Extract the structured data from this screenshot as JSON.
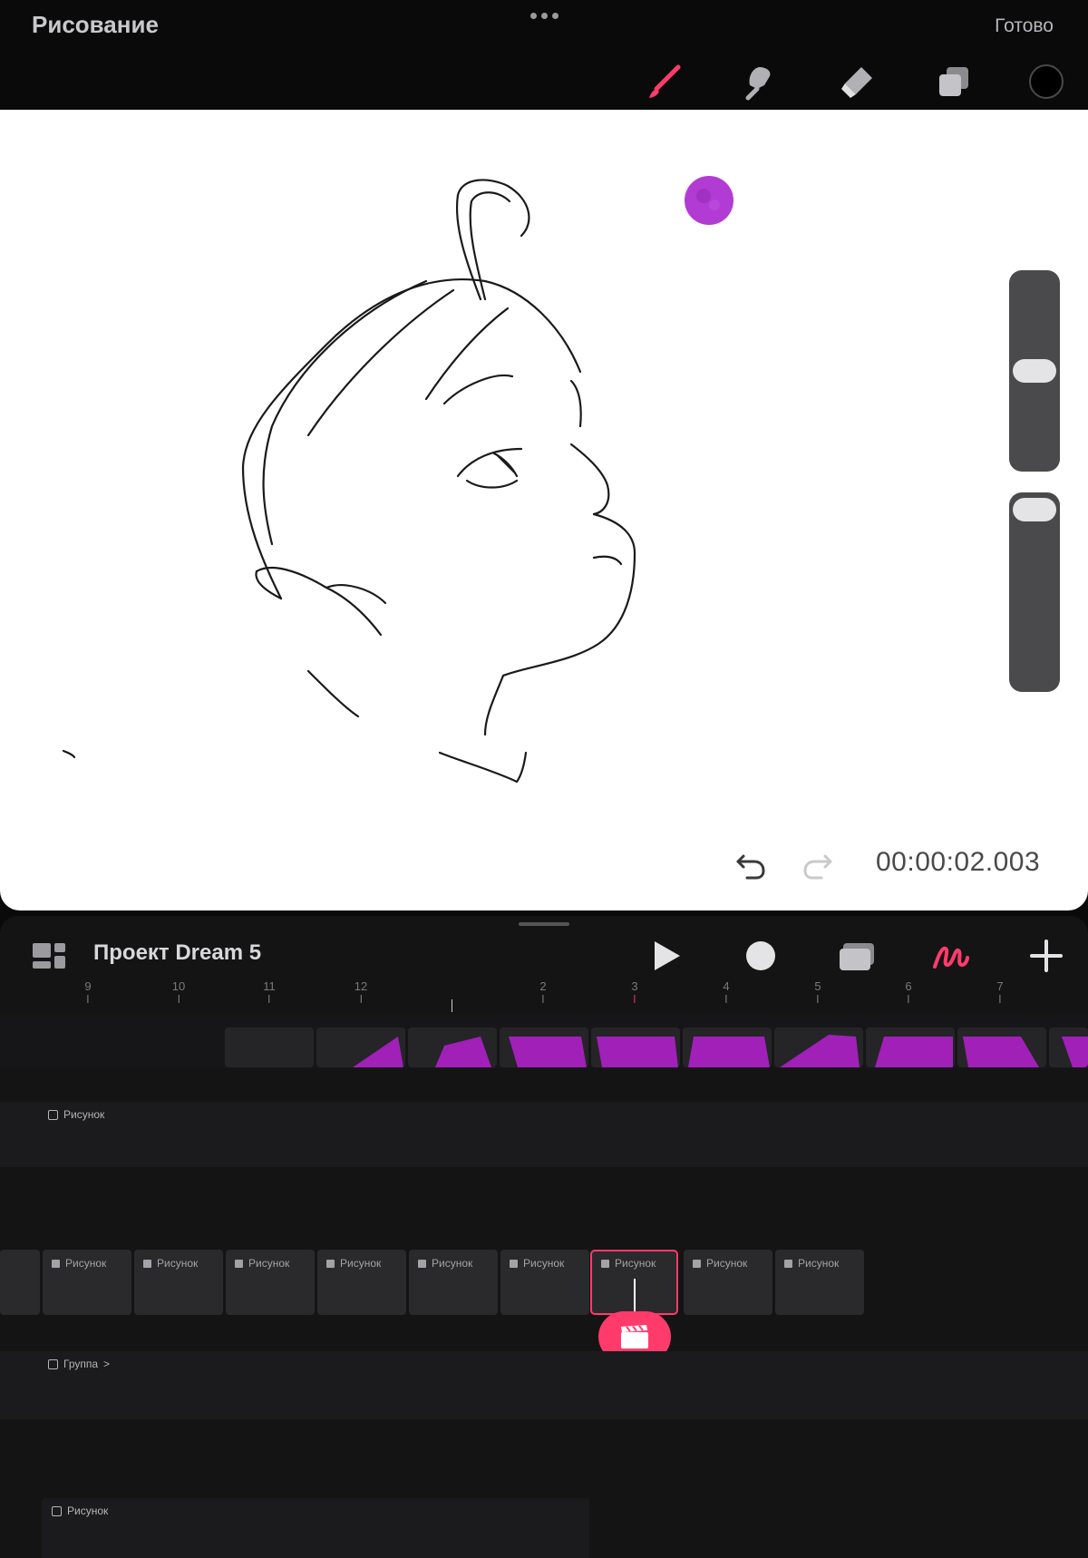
{
  "topbar": {
    "title": "Рисование",
    "done_label": "Готово",
    "tools": [
      {
        "name": "brush",
        "icon": "brush-icon",
        "active": true
      },
      {
        "name": "smudge",
        "icon": "smudge-icon"
      },
      {
        "name": "eraser",
        "icon": "eraser-icon"
      },
      {
        "name": "layers",
        "icon": "layers-icon"
      }
    ],
    "color": "#000000",
    "accent": "#ff3b6b"
  },
  "canvas": {
    "timecode": "00:00:02.003",
    "undo_icon": "undo-icon",
    "redo_icon": "redo-icon",
    "brush_preview_color": "#b23bd4"
  },
  "timeline": {
    "project_name": "Проект Dream 5",
    "header_icons": [
      "gallery-icon",
      "play-icon",
      "record-icon",
      "onion-skin-icon",
      "draw-icon",
      "plus-icon"
    ],
    "ruler": [
      "9",
      "10",
      "11",
      "12",
      "2",
      "3",
      "4",
      "5",
      "6",
      "7"
    ],
    "time_marker": "2s",
    "tracks": [
      {
        "label": "Рисунок"
      },
      {
        "label": "Рисунок"
      },
      {
        "label": "Группа",
        "has_chevron": true
      },
      {
        "label": "Рисунок"
      }
    ],
    "frames": [
      {
        "label": "Рисунок"
      },
      {
        "label": "Рисунок"
      },
      {
        "label": "Рисунок"
      },
      {
        "label": "Рисунок"
      },
      {
        "label": "Рисунок"
      },
      {
        "label": "Рисунок"
      },
      {
        "label": "Рисунок",
        "selected": true
      },
      {
        "label": "Рисунок"
      },
      {
        "label": "Рисунок"
      }
    ],
    "group_chevron": ">"
  }
}
